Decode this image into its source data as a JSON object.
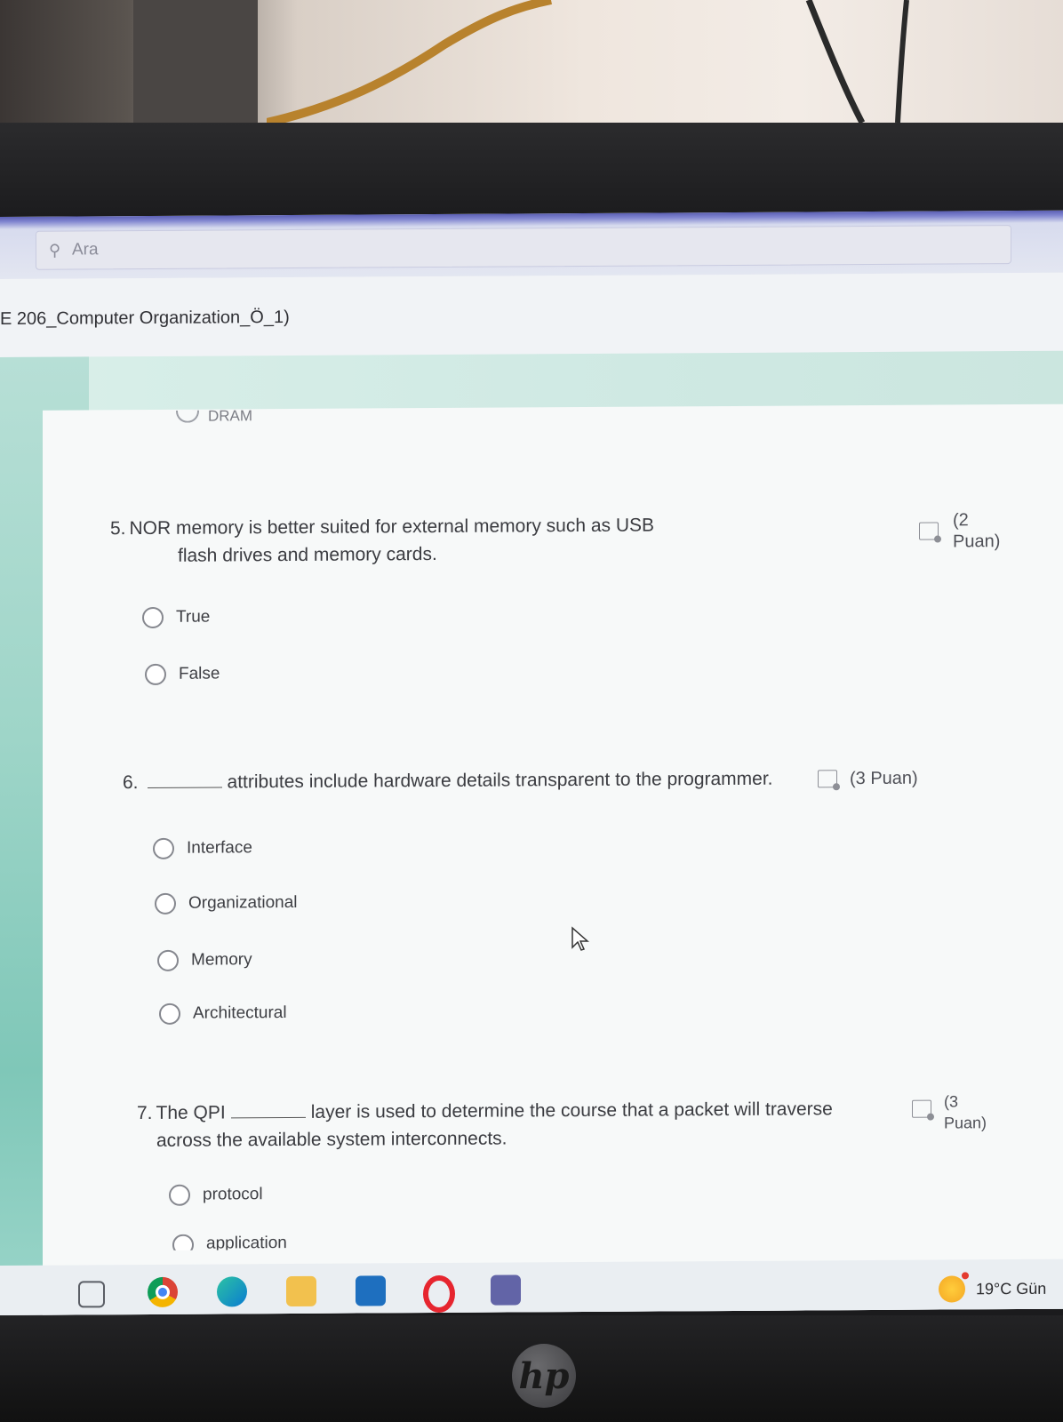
{
  "search": {
    "placeholder": "Ara"
  },
  "form": {
    "title": "E 206_Computer Organization_Ö_1)",
    "partial_option": "DRAM",
    "questions": [
      {
        "number": "5.",
        "text_line1": "NOR memory is better suited for external memory such as USB",
        "text_line2": "flash drives and memory cards.",
        "points_line1": "(2",
        "points_line2": "Puan)",
        "options": [
          "True",
          "False"
        ]
      },
      {
        "number": "6.",
        "text": "attributes include hardware details transparent to the programmer.",
        "points": "(3 Puan)",
        "options": [
          "Interface",
          "Organizational",
          "Memory",
          "Architectural"
        ]
      },
      {
        "number": "7.",
        "text_before": "The QPI",
        "text_after": "layer is used to determine the course that a packet will traverse",
        "text_line2": "across the available system interconnects.",
        "points_line1": "(3",
        "points_line2": "Puan)",
        "options": [
          "protocol",
          "application"
        ]
      }
    ]
  },
  "taskbar": {
    "icons": [
      "task-view-icon",
      "chrome-icon",
      "edge-icon",
      "file-explorer-icon",
      "mail-icon",
      "opera-icon",
      "teams-icon"
    ],
    "weather": "19°C Gün"
  },
  "device": {
    "brand": "hp"
  }
}
